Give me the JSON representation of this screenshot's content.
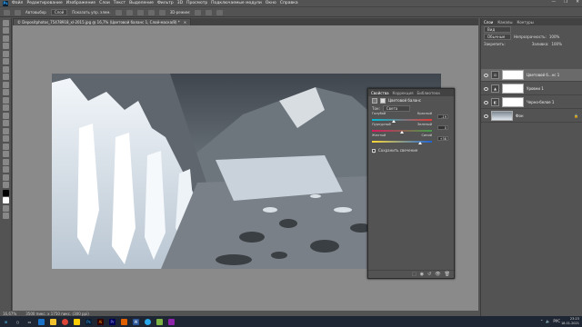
{
  "menubar": {
    "app_icon": "Ps",
    "items": [
      "Файл",
      "Редактирование",
      "Изображение",
      "Слои",
      "Текст",
      "Выделение",
      "Фильтр",
      "3D",
      "Просмотр",
      "Подключаемые модули",
      "Окно",
      "Справка"
    ],
    "window_controls": [
      "—",
      "❐",
      "✕"
    ]
  },
  "options": {
    "autoselect": "Автовыбор",
    "layer_select": "Слой",
    "show_controls": "Показать упр. элем.",
    "mode_3d": "3D-режим:"
  },
  "document": {
    "tab_title": "© Depositphotos_75478918_xl-2015.jpg @ 16,7% (Цветовой баланс 1, Слой-маска/8) *",
    "close": "×"
  },
  "status": {
    "zoom": "16,67%",
    "doc_size": "3500 пикс. x 1750 пикс. (300 ppi)"
  },
  "panels": {
    "tabs": [
      "Слои",
      "Каналы",
      "Контуры"
    ],
    "active_tab": "Слои",
    "search_placeholder": "Вид",
    "blend_mode": "Обычные",
    "opacity_label": "Непрозрачность:",
    "opacity_value": "100%",
    "lock_label": "Закрепить:",
    "fill_label": "Заливка:",
    "fill_value": "100%",
    "layers": [
      {
        "name": "Цветовой б...нс 1",
        "type": "adjustment",
        "selected": true
      },
      {
        "name": "Уровни 1",
        "type": "adjustment",
        "selected": false
      },
      {
        "name": "Черно-белое 1",
        "type": "adjustment",
        "selected": false
      },
      {
        "name": "Фон",
        "type": "image",
        "selected": false
      }
    ]
  },
  "properties": {
    "tabs": [
      "Свойства",
      "Коррекция",
      "Библиотеки"
    ],
    "active_tab": "Свойства",
    "title": "Цветовой баланс",
    "tone_label": "Тон:",
    "tone_value": "Света",
    "sliders": [
      {
        "left": "Голубой",
        "right": "Красный",
        "value": "-19",
        "fraction": 0.36,
        "left_color": "#00bcd4",
        "right_color": "#e53935"
      },
      {
        "left": "Пурпурный",
        "right": "Зеленый",
        "value": "0",
        "fraction": 0.5,
        "left_color": "#d81b60",
        "right_color": "#43a047"
      },
      {
        "left": "Желтый",
        "right": "Синий",
        "value": "+38",
        "fraction": 0.8,
        "left_color": "#fdd835",
        "right_color": "#1e63d6"
      }
    ],
    "preserve_label": "Сохранить свечение",
    "footer_icons": [
      "clip-icon",
      "view-previous-icon",
      "reset-icon",
      "visibility-icon",
      "trash-icon"
    ]
  },
  "taskbar": {
    "time": "23:23",
    "date": "18.01.2021",
    "lang": "РУС"
  },
  "colors": {
    "ui_bg": "#535353",
    "canvas_bg": "#8a8a8a",
    "accent": "#31a8ff"
  }
}
